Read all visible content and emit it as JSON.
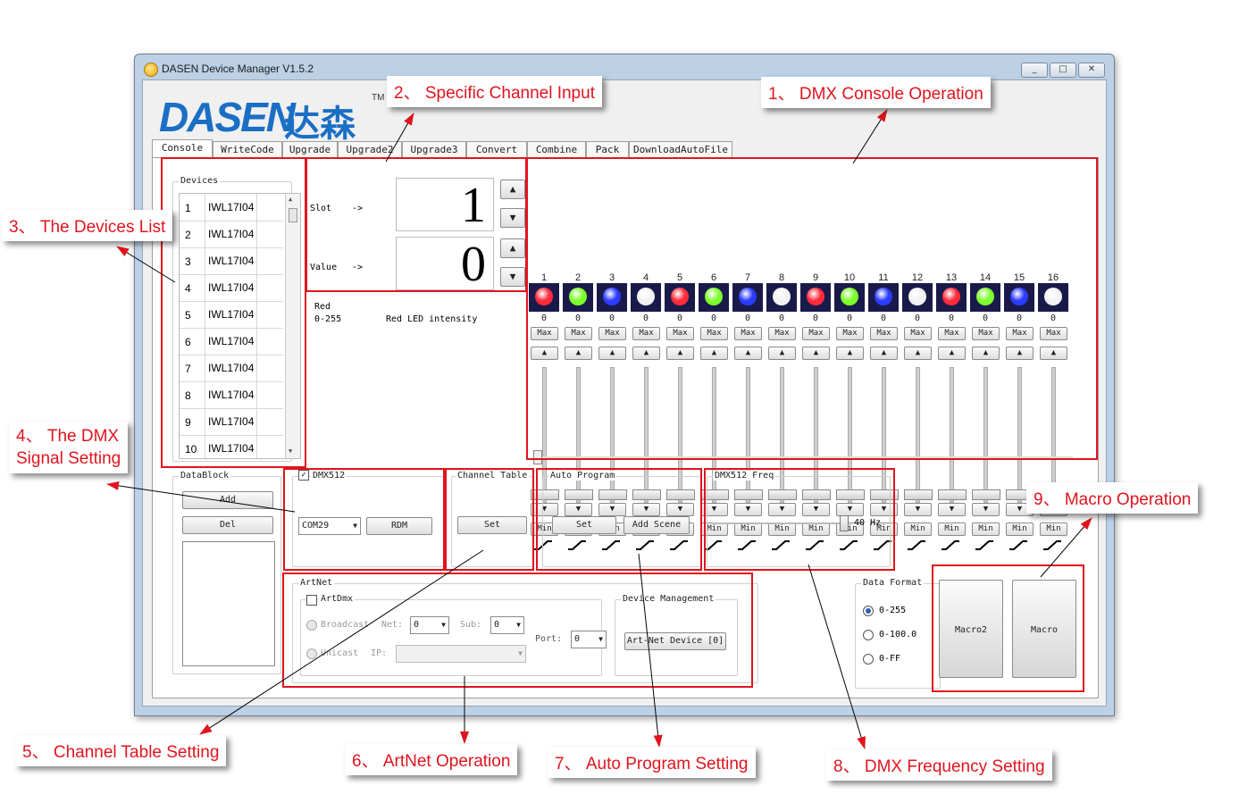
{
  "window": {
    "title": "DASEN Device Manager V1.5.2",
    "controls": [
      "_",
      "□",
      "✕"
    ]
  },
  "logo": {
    "latin": "DASEN",
    "cjk": "达森",
    "tm": "TM"
  },
  "tabs": [
    "Console",
    "WriteCode",
    "Upgrade",
    "Upgrade2",
    "Upgrade3",
    "Convert",
    "Combine",
    "Pack",
    "DownloadAutoFile"
  ],
  "devices": {
    "label": "Devices",
    "items": [
      {
        "n": "1",
        "model": "IWL17I04"
      },
      {
        "n": "2",
        "model": "IWL17I04"
      },
      {
        "n": "3",
        "model": "IWL17I04"
      },
      {
        "n": "4",
        "model": "IWL17I04"
      },
      {
        "n": "5",
        "model": "IWL17I04"
      },
      {
        "n": "6",
        "model": "IWL17I04"
      },
      {
        "n": "7",
        "model": "IWL17I04"
      },
      {
        "n": "8",
        "model": "IWL17I04"
      },
      {
        "n": "9",
        "model": "IWL17I04"
      },
      {
        "n": "10",
        "model": "IWL17I04"
      }
    ]
  },
  "channel_input": {
    "slot_label": "Slot",
    "slot_arrow": "->",
    "slot_value": "1",
    "value_label": "Value",
    "value_arrow": "->",
    "value_value": "0",
    "info_name": "Red",
    "info_range": "0-255",
    "info_desc": "Red LED intensity"
  },
  "console": {
    "max_label": "Max",
    "min_label": "Min",
    "channels": [
      {
        "n": "1",
        "color": "#ff2a3a",
        "value": "0"
      },
      {
        "n": "2",
        "color": "#7cff2a",
        "value": "0"
      },
      {
        "n": "3",
        "color": "#2a3aff",
        "value": "0"
      },
      {
        "n": "4",
        "color": "#f2f2f2",
        "value": "0"
      },
      {
        "n": "5",
        "color": "#ff2a3a",
        "value": "0"
      },
      {
        "n": "6",
        "color": "#7cff2a",
        "value": "0"
      },
      {
        "n": "7",
        "color": "#2a3aff",
        "value": "0"
      },
      {
        "n": "8",
        "color": "#f2f2f2",
        "value": "0"
      },
      {
        "n": "9",
        "color": "#ff2a3a",
        "value": "0"
      },
      {
        "n": "10",
        "color": "#7cff2a",
        "value": "0"
      },
      {
        "n": "11",
        "color": "#2a3aff",
        "value": "0"
      },
      {
        "n": "12",
        "color": "#f2f2f2",
        "value": "0"
      },
      {
        "n": "13",
        "color": "#ff2a3a",
        "value": "0"
      },
      {
        "n": "14",
        "color": "#7cff2a",
        "value": "0"
      },
      {
        "n": "15",
        "color": "#2a3aff",
        "value": "0"
      },
      {
        "n": "16",
        "color": "#f2f2f2",
        "value": "0"
      }
    ]
  },
  "datablock": {
    "label": "DataBlock",
    "add": "Add",
    "del": "Del"
  },
  "dmx512": {
    "label": "DMX512",
    "checked": true,
    "port": "COM29",
    "rdm": "RDM"
  },
  "channel_table": {
    "label": "Channel Table",
    "set": "Set"
  },
  "auto_program": {
    "label": "Auto Program",
    "set": "Set",
    "add_scene": "Add Scene"
  },
  "freq": {
    "label": "DMX512 Freq",
    "value": "40 Hz",
    "level": 1.0
  },
  "artnet": {
    "label": "ArtNet",
    "artdmx": "ArtDmx",
    "broadcast": "Broadcast",
    "net_label": "Net:",
    "net_value": "0",
    "sub_label": "Sub:",
    "sub_value": "0",
    "unicast": "Unicast",
    "ip_label": "IP:",
    "port_label": "Port:",
    "port_value": "0",
    "device_mgmt_label": "Device Management",
    "device_button": "Art-Net Device [0]"
  },
  "data_format": {
    "label": "Data Format",
    "options": [
      "0-255",
      "0-100.0",
      "0-FF"
    ],
    "selected": "0-255"
  },
  "macros": {
    "macro2": "Macro2",
    "macro": "Macro"
  },
  "annotations": {
    "a1": "1、 DMX Console Operation",
    "a2": "2、 Specific Channel Input",
    "a3": "3、 The Devices List",
    "a4_line1": "4、 The DMX",
    "a4_line2": "Signal Setting",
    "a5": "5、 Channel Table Setting",
    "a6": "6、 ArtNet Operation",
    "a7": "7、 Auto Program Setting",
    "a8": "8、 DMX Frequency Setting",
    "a9": "9、 Macro Operation"
  },
  "colors": {
    "annotation_red": "#e0141e",
    "logo_blue": "#1a6fc4"
  }
}
